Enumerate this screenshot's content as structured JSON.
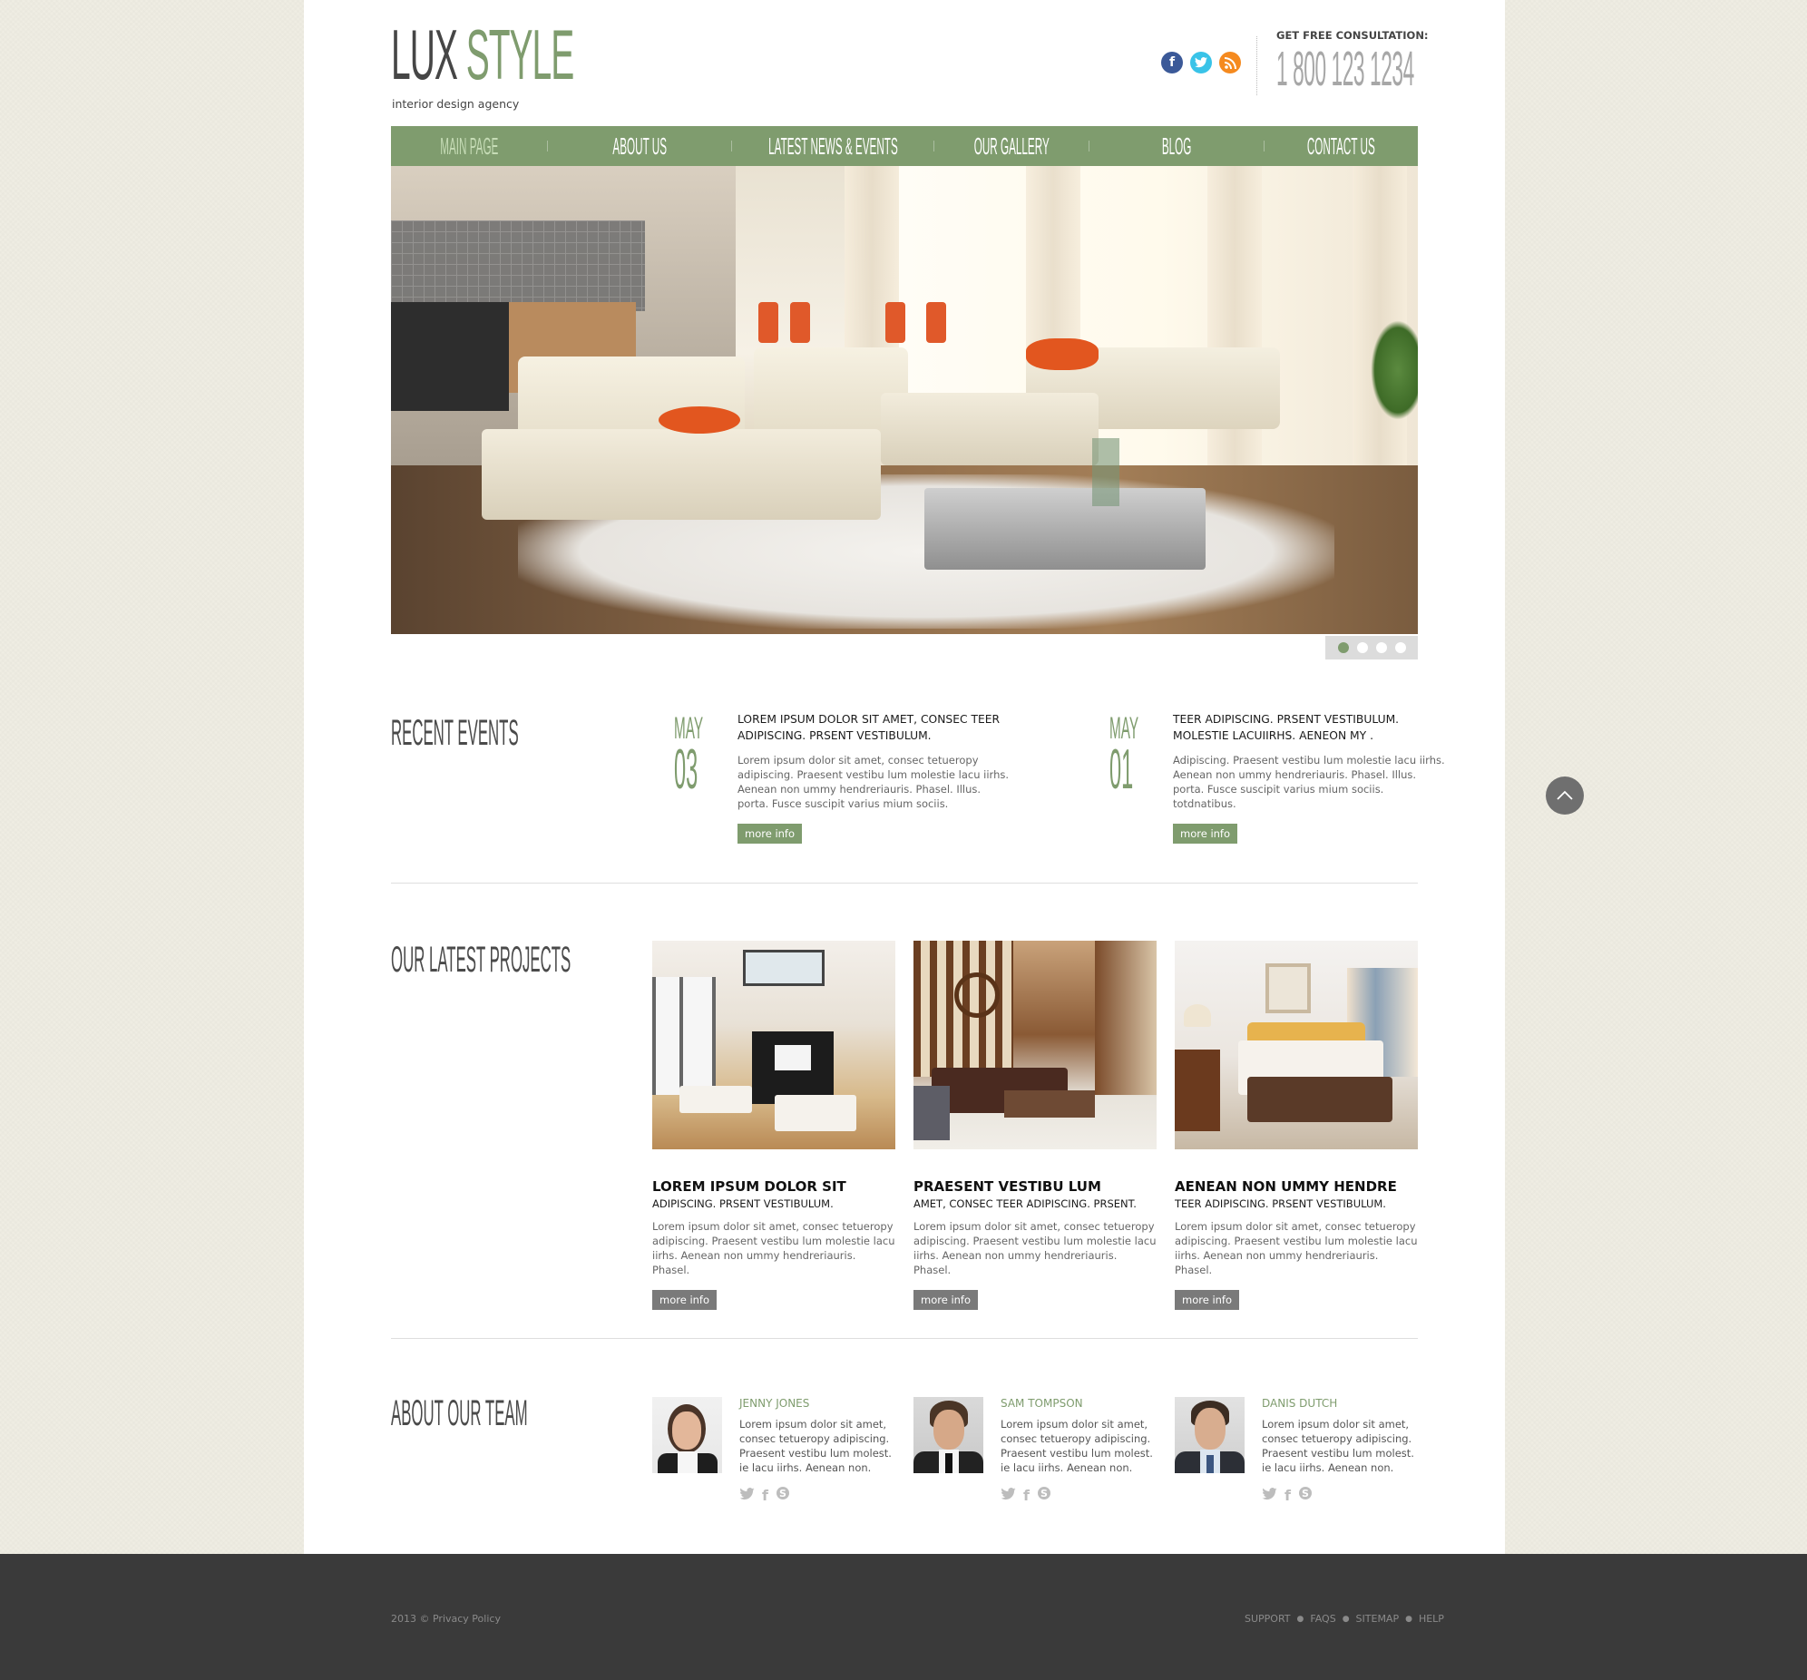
{
  "header": {
    "logo_part1": "LUX",
    "logo_part2": "STYLE",
    "tagline": "interior design agency",
    "consultation_label": "GET FREE CONSULTATION:",
    "phone": "1 800 123 1234",
    "social_icons": [
      "facebook-icon",
      "twitter-icon",
      "rss-icon"
    ]
  },
  "nav": {
    "items": [
      {
        "label": "MAIN PAGE",
        "active": true
      },
      {
        "label": "ABOUT US",
        "active": false
      },
      {
        "label": "LATEST NEWS & EVENTS",
        "active": false
      },
      {
        "label": "OUR GALLERY",
        "active": false
      },
      {
        "label": "BLOG",
        "active": false
      },
      {
        "label": "CONTACT US",
        "active": false
      }
    ]
  },
  "slider": {
    "slide_count": 4,
    "active_slide": 1
  },
  "recent_events": {
    "title": "RECENT EVENTS",
    "events": [
      {
        "month": "MAY",
        "day": "03",
        "title": "LOREM IPSUM DOLOR SIT AMET, CONSEC TEER ADIPISCING. PRSENT VESTIBULUM.",
        "text": "Lorem ipsum dolor sit amet, consec tetueropy adipiscing. Praesent vestibu lum molestie lacu iirhs. Aenean non ummy hendreriauris. Phasel. Illus. porta. Fusce suscipit varius mium sociis.",
        "button": "more info"
      },
      {
        "month": "MAY",
        "day": "01",
        "title": "TEER ADIPISCING. PRSENT VESTIBULUM. MOLESTIE LACUIIRHS. AENEON MY .",
        "text": "Adipiscing. Praesent vestibu lum molestie lacu iirhs. Aenean non ummy hendreriauris. Phasel. Illus. porta. Fusce suscipit varius mium sociis. totdnatibus.",
        "button": "more info"
      }
    ]
  },
  "projects": {
    "title": "OUR LATEST PROJECTS",
    "items": [
      {
        "title": "LOREM IPSUM DOLOR SIT",
        "subtitle": "ADIPISCING. PRSENT VESTIBULUM.",
        "text": "Lorem ipsum dolor sit amet, consec tetueropy adipiscing. Praesent vestibu lum molestie lacu iirhs. Aenean non ummy hendreriauris. Phasel.",
        "button": "more info"
      },
      {
        "title": "PRAESENT VESTIBU LUM",
        "subtitle": "AMET, CONSEC TEER ADIPISCING. PRSENT.",
        "text": "Lorem ipsum dolor sit amet, consec tetueropy adipiscing. Praesent vestibu lum molestie lacu iirhs. Aenean non ummy hendreriauris. Phasel.",
        "button": "more info"
      },
      {
        "title": "AENEAN NON UMMY HENDRE",
        "subtitle": "TEER ADIPISCING. PRSENT VESTIBULUM.",
        "text": "Lorem ipsum dolor sit amet, consec tetueropy adipiscing. Praesent vestibu lum molestie lacu iirhs. Aenean non ummy hendreriauris. Phasel.",
        "button": "more info"
      }
    ]
  },
  "team": {
    "title": "ABOUT OUR TEAM",
    "members": [
      {
        "name": "JENNY JONES",
        "text": "Lorem ipsum dolor sit amet, consec tetueropy adipiscing. Praesent vestibu lum molest. ie lacu iirhs. Aenean non."
      },
      {
        "name": "SAM TOMPSON",
        "text": "Lorem ipsum dolor sit amet, consec tetueropy adipiscing. Praesent vestibu lum molest. ie lacu iirhs. Aenean non."
      },
      {
        "name": "DANIS DUTCH",
        "text": "Lorem ipsum dolor sit amet, consec tetueropy adipiscing. Praesent vestibu lum molest. ie lacu iirhs. Aenean non."
      }
    ],
    "social_icons": [
      "twitter-icon",
      "facebook-icon",
      "skype-icon"
    ]
  },
  "footer": {
    "copyright": "2013 © Privacy Policy",
    "links": [
      "SUPPORT",
      "FAQS",
      "SITEMAP",
      "HELP"
    ]
  },
  "colors": {
    "accent_green": "#7f9c6e",
    "dark_text": "#464646",
    "footer_bg": "#3a3a3a",
    "page_bg": "#efede3"
  }
}
